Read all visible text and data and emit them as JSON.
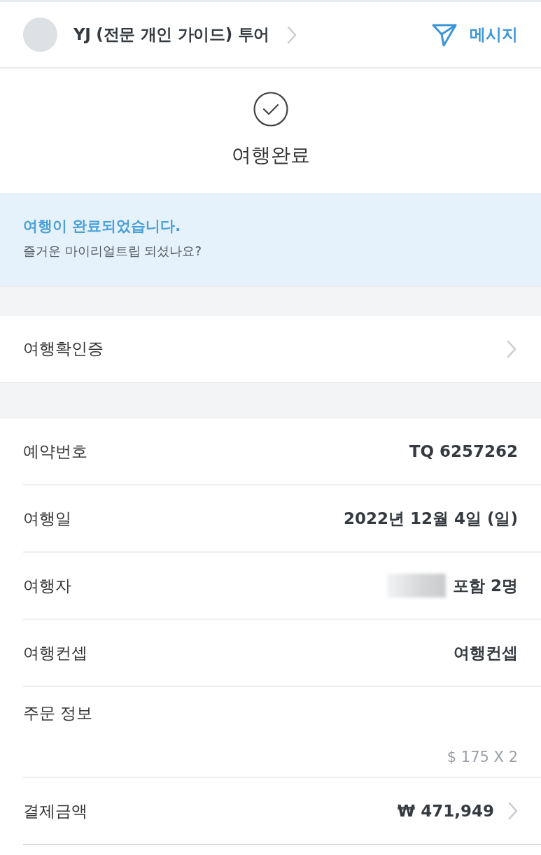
{
  "header": {
    "title": "YJ (전문 개인 가이드) 투어",
    "message_button": "메시지"
  },
  "status": {
    "title": "여행완료"
  },
  "notice": {
    "headline": "여행이 완료되었습니다.",
    "subtext": "즐거운 마이리얼트립 되셨나요?"
  },
  "certificate_link": {
    "label": "여행확인증"
  },
  "details": [
    {
      "label": "예약번호",
      "value": "TQ 6257262",
      "redacted": false,
      "link": false
    },
    {
      "label": "여행일",
      "value": "2022년 12월 4일 (일)",
      "redacted": false,
      "link": false
    },
    {
      "label": "여행자",
      "value": "포함 2명",
      "redacted": true,
      "link": false
    },
    {
      "label": "여행컨셉",
      "value": "여행컨셉",
      "redacted": false,
      "link": false
    },
    {
      "label": "주문 정보",
      "note": "$ 175 X 2",
      "redacted": false,
      "link": false
    },
    {
      "label": "결제금액",
      "value": "₩ 471,949",
      "redacted": false,
      "link": true
    }
  ]
}
